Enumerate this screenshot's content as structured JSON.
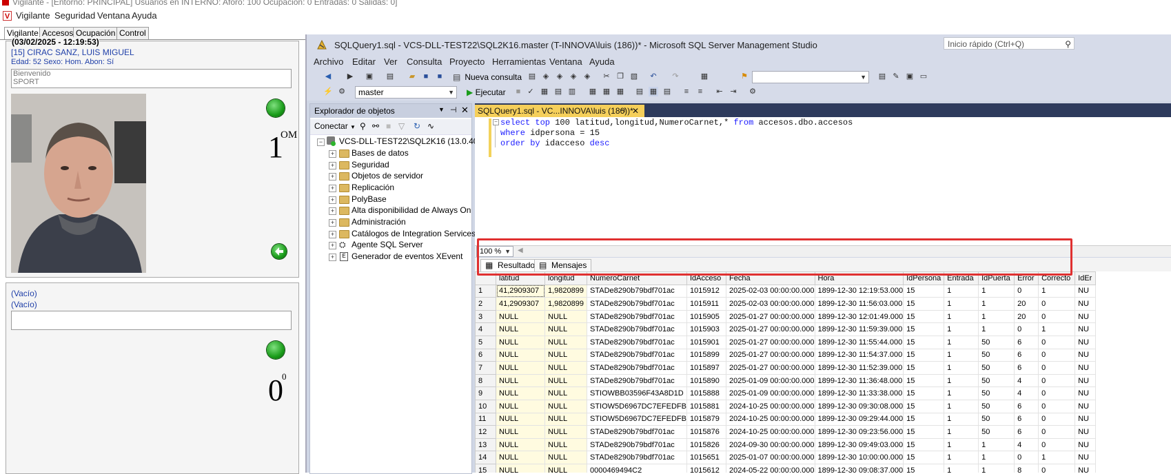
{
  "vigilante": {
    "title": "Vigilante - [Entorno: PRINCIPAL] Usuarios en INTERNO: Aforo: 100 Ocupación: 0 Entradas: 0 Salidas: 0]",
    "menu": [
      "Vigilante",
      "Seguridad",
      "Ventana",
      "Ayuda"
    ],
    "tabs": [
      "Vigilante",
      "Accesos",
      "Ocupación",
      "Control"
    ],
    "panel1": {
      "datetime": "(03/02/2025 - 12:19:53)",
      "person": "[15] CIRAC SANZ, LUIS MIGUEL",
      "details": "Edad: 52  Sexo: Hom.  Abon: Sí",
      "message_line1": "Bienvenido",
      "message_line2": "SPORT",
      "counter": "1",
      "counter_sup": "OM"
    },
    "panel2": {
      "line1": "(Vacío)",
      "line2": "(Vacío)",
      "counter": "0",
      "counter_sup": "0"
    }
  },
  "ssms": {
    "title": "SQLQuery1.sql - VCS-DLL-TEST22\\SQL2K16.master (T-INNOVA\\luis (186))* - Microsoft SQL Server Management Studio",
    "quick_launch": "Inicio rápido (Ctrl+Q)",
    "menu": [
      "Archivo",
      "Editar",
      "Ver",
      "Consulta",
      "Proyecto",
      "Herramientas",
      "Ventana",
      "Ayuda"
    ],
    "toolbar": {
      "new_query": "Nueva consulta",
      "database": "master",
      "execute": "Ejecutar"
    },
    "object_explorer": {
      "title": "Explorador de objetos",
      "connect": "Conectar",
      "server": "VCS-DLL-TEST22\\SQL2K16 (13.0.4001.0",
      "nodes": [
        "Bases de datos",
        "Seguridad",
        "Objetos de servidor",
        "Replicación",
        "PolyBase",
        "Alta disponibilidad de Always On",
        "Administración",
        "Catálogos de Integration Services",
        "Agente SQL Server",
        "Generador de eventos XEvent"
      ]
    },
    "doc_tab": "SQLQuery1.sql - VC...INNOVA\\luis (186))*",
    "query": {
      "l1_kw1": "select top",
      "l1_txt1": " 100 latitud,longitud,NumeroCarnet,",
      "l1_star": "*",
      "l1_kw2": " from",
      "l1_txt2": " accesos.dbo.accesos",
      "l2_kw": "where",
      "l2_txt": " idpersona = 15",
      "l3_kw": "order by",
      "l3_txt": " idacceso ",
      "l3_kw2": "desc"
    },
    "zoom": "100 %",
    "result_tabs": [
      "Resultados",
      "Mensajes"
    ],
    "columns": [
      "latitud",
      "longitud",
      "NumeroCarnet",
      "IdAcceso",
      "Fecha",
      "Hora",
      "IdPersona",
      "Entrada",
      "IdPuerta",
      "Error",
      "Correcto",
      "IdEr"
    ],
    "rows": [
      [
        "1",
        "41,2909307",
        "1,9820899",
        "STADe8290b79bdf701ac",
        "1015912",
        "2025-02-03 00:00:00.000",
        "1899-12-30 12:19:53.000",
        "15",
        "1",
        "1",
        "0",
        "1",
        "NU"
      ],
      [
        "2",
        "41,2909307",
        "1,9820899",
        "STADe8290b79bdf701ac",
        "1015911",
        "2025-02-03 00:00:00.000",
        "1899-12-30 11:56:03.000",
        "15",
        "1",
        "1",
        "20",
        "0",
        "NU"
      ],
      [
        "3",
        "NULL",
        "NULL",
        "STADe8290b79bdf701ac",
        "1015905",
        "2025-01-27 00:00:00.000",
        "1899-12-30 12:01:49.000",
        "15",
        "1",
        "1",
        "20",
        "0",
        "NU"
      ],
      [
        "4",
        "NULL",
        "NULL",
        "STADe8290b79bdf701ac",
        "1015903",
        "2025-01-27 00:00:00.000",
        "1899-12-30 11:59:39.000",
        "15",
        "1",
        "1",
        "0",
        "1",
        "NU"
      ],
      [
        "5",
        "NULL",
        "NULL",
        "STADe8290b79bdf701ac",
        "1015901",
        "2025-01-27 00:00:00.000",
        "1899-12-30 11:55:44.000",
        "15",
        "1",
        "50",
        "6",
        "0",
        "NU"
      ],
      [
        "6",
        "NULL",
        "NULL",
        "STADe8290b79bdf701ac",
        "1015899",
        "2025-01-27 00:00:00.000",
        "1899-12-30 11:54:37.000",
        "15",
        "1",
        "50",
        "6",
        "0",
        "NU"
      ],
      [
        "7",
        "NULL",
        "NULL",
        "STADe8290b79bdf701ac",
        "1015897",
        "2025-01-27 00:00:00.000",
        "1899-12-30 11:52:39.000",
        "15",
        "1",
        "50",
        "6",
        "0",
        "NU"
      ],
      [
        "8",
        "NULL",
        "NULL",
        "STADe8290b79bdf701ac",
        "1015890",
        "2025-01-09 00:00:00.000",
        "1899-12-30 11:36:48.000",
        "15",
        "1",
        "50",
        "4",
        "0",
        "NU"
      ],
      [
        "9",
        "NULL",
        "NULL",
        "STIOWBB03596F43A8D1D",
        "1015888",
        "2025-01-09 00:00:00.000",
        "1899-12-30 11:33:38.000",
        "15",
        "1",
        "50",
        "4",
        "0",
        "NU"
      ],
      [
        "10",
        "NULL",
        "NULL",
        "STIOW5D6967DC7EFEDFB",
        "1015881",
        "2024-10-25 00:00:00.000",
        "1899-12-30 09:30:08.000",
        "15",
        "1",
        "50",
        "6",
        "0",
        "NU"
      ],
      [
        "11",
        "NULL",
        "NULL",
        "STIOW5D6967DC7EFEDFB",
        "1015879",
        "2024-10-25 00:00:00.000",
        "1899-12-30 09:29:44.000",
        "15",
        "1",
        "50",
        "6",
        "0",
        "NU"
      ],
      [
        "12",
        "NULL",
        "NULL",
        "STADe8290b79bdf701ac",
        "1015876",
        "2024-10-25 00:00:00.000",
        "1899-12-30 09:23:56.000",
        "15",
        "1",
        "50",
        "6",
        "0",
        "NU"
      ],
      [
        "13",
        "NULL",
        "NULL",
        "STADe8290b79bdf701ac",
        "1015826",
        "2024-09-30 00:00:00.000",
        "1899-12-30 09:49:03.000",
        "15",
        "1",
        "1",
        "4",
        "0",
        "NU"
      ],
      [
        "14",
        "NULL",
        "NULL",
        "STADe8290b79bdf701ac",
        "1015651",
        "2025-01-07 00:00:00.000",
        "1899-12-30 10:00:00.000",
        "15",
        "1",
        "1",
        "0",
        "1",
        "NU"
      ],
      [
        "15",
        "NULL",
        "NULL",
        "0000469494C2",
        "1015612",
        "2024-05-22 00:00:00.000",
        "1899-12-30 09:08:37.000",
        "15",
        "1",
        "1",
        "8",
        "0",
        "NU"
      ]
    ]
  }
}
